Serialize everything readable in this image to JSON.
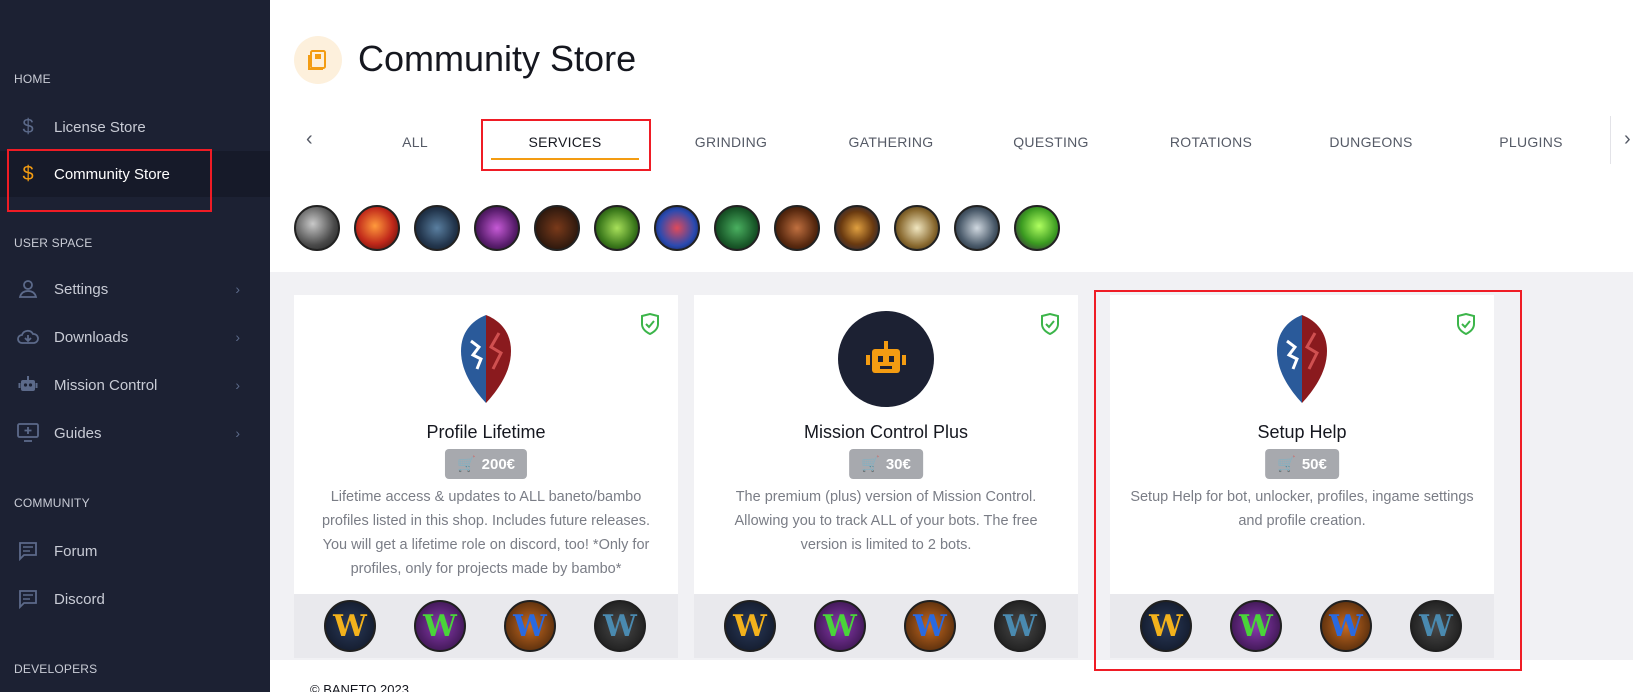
{
  "sidebar": {
    "sections": {
      "home": "HOME",
      "user_space": "USER SPACE",
      "community": "COMMUNITY",
      "developers": "DEVELOPERS"
    },
    "items": [
      {
        "label": "License Store",
        "icon": "dollar-icon"
      },
      {
        "label": "Community Store",
        "icon": "dollar-icon",
        "active": true
      },
      {
        "label": "Settings",
        "icon": "user-icon"
      },
      {
        "label": "Downloads",
        "icon": "cloud-download-icon"
      },
      {
        "label": "Mission Control",
        "icon": "robot-icon"
      },
      {
        "label": "Guides",
        "icon": "monitor-icon"
      },
      {
        "label": "Forum",
        "icon": "chat-icon"
      },
      {
        "label": "Discord",
        "icon": "chat-icon"
      }
    ]
  },
  "header": {
    "title": "Community Store",
    "icon": "store-icon"
  },
  "tabs": [
    "ALL",
    "SERVICES",
    "GRINDING",
    "GATHERING",
    "QUESTING",
    "ROTATIONS",
    "DUNGEONS",
    "PLUGINS"
  ],
  "active_tab": "SERVICES",
  "class_icons": [
    "warrior",
    "fire-mage",
    "hunter",
    "warlock",
    "druid",
    "rogue",
    "shaman",
    "monk",
    "paladin",
    "priest",
    "death-knight",
    "demon-hunter",
    "evoker"
  ],
  "cards": [
    {
      "name": "Profile Lifetime",
      "price": "200€",
      "emblem": "alliance-horde-emblem",
      "description": "Lifetime access & updates to ALL baneto/bambo profiles listed in this shop. Includes future releases. You will get a lifetime role on discord, too! *Only for profiles, only for projects made by bambo*"
    },
    {
      "name": "Mission Control Plus",
      "price": "30€",
      "emblem": "robot-emblem",
      "description": "The premium (plus) version of Mission Control. Allowing you to track ALL of your bots. The free version is limited to 2 bots."
    },
    {
      "name": "Setup Help",
      "price": "50€",
      "emblem": "alliance-horde-emblem",
      "description": "Setup Help for bot, unlocker, profiles, ingame settings and profile creation."
    }
  ],
  "game_icons": [
    "W",
    "W",
    "W",
    "W"
  ],
  "colors": {
    "accent": "#f39c12",
    "sidebar_bg": "#1c2133",
    "highlight": "#ef1c25",
    "verified": "#3cb54a"
  },
  "footer": {
    "text": "© BANETO 2023"
  }
}
